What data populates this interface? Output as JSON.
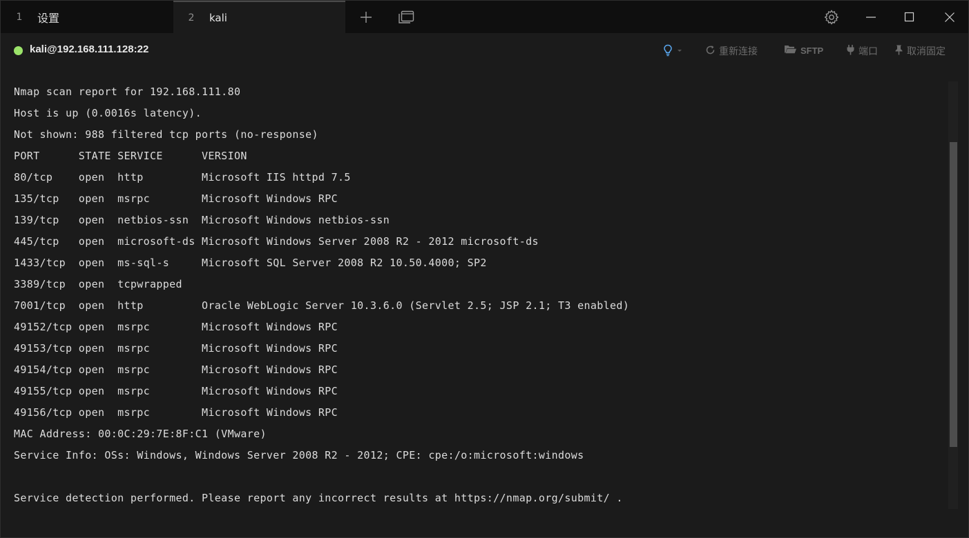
{
  "tabs": [
    {
      "number": "1",
      "title": "设置"
    },
    {
      "number": "2",
      "title": "kali"
    }
  ],
  "session": {
    "host": "kali@192.168.111.128:22",
    "status_color": "#9be36a",
    "actions": {
      "reconnect": "重新连接",
      "sftp": "SFTP",
      "port": "端口",
      "unpin": "取消固定"
    }
  },
  "terminal": {
    "lines": [
      "Nmap scan report for 192.168.111.80",
      "Host is up (0.0016s latency).",
      "Not shown: 988 filtered tcp ports (no-response)",
      "PORT      STATE SERVICE      VERSION",
      "80/tcp    open  http         Microsoft IIS httpd 7.5",
      "135/tcp   open  msrpc        Microsoft Windows RPC",
      "139/tcp   open  netbios-ssn  Microsoft Windows netbios-ssn",
      "445/tcp   open  microsoft-ds Microsoft Windows Server 2008 R2 - 2012 microsoft-ds",
      "1433/tcp  open  ms-sql-s     Microsoft SQL Server 2008 R2 10.50.4000; SP2",
      "3389/tcp  open  tcpwrapped",
      "7001/tcp  open  http         Oracle WebLogic Server 10.3.6.0 (Servlet 2.5; JSP 2.1; T3 enabled)",
      "49152/tcp open  msrpc        Microsoft Windows RPC",
      "49153/tcp open  msrpc        Microsoft Windows RPC",
      "49154/tcp open  msrpc        Microsoft Windows RPC",
      "49155/tcp open  msrpc        Microsoft Windows RPC",
      "49156/tcp open  msrpc        Microsoft Windows RPC",
      "MAC Address: 00:0C:29:7E:8F:C1 (VMware)",
      "Service Info: OSs: Windows, Windows Server 2008 R2 - 2012; CPE: cpe:/o:microsoft:windows",
      "",
      "Service detection performed. Please report any incorrect results at https://nmap.org/submit/ ."
    ]
  },
  "icons": {
    "new_tab": "plus-icon",
    "tab_overview": "window-stack-icon",
    "settings": "gear-icon",
    "minimize": "minimize-icon",
    "maximize": "maximize-icon",
    "close": "close-icon",
    "tips": "lightbulb-icon",
    "reconnect": "refresh-icon",
    "sftp": "folder-icon",
    "port": "plug-icon",
    "unpin": "pin-icon"
  }
}
